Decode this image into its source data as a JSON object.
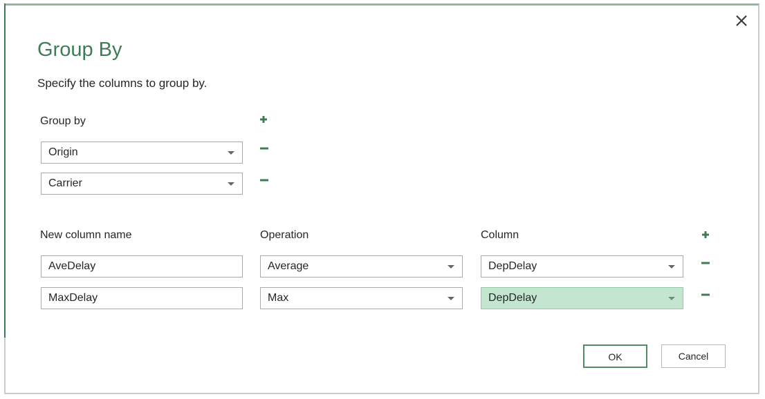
{
  "dialog": {
    "title": "Group By",
    "subtitle": "Specify the columns to group by.",
    "close_icon": "close-icon",
    "accent_color": "#3f7c56"
  },
  "group_by": {
    "label": "Group by",
    "rows": [
      {
        "value": "Origin"
      },
      {
        "value": "Carrier"
      }
    ]
  },
  "aggregations": {
    "headers": {
      "new_column_name": "New column name",
      "operation": "Operation",
      "column": "Column"
    },
    "rows": [
      {
        "name": "AveDelay",
        "operation": "Average",
        "column": "DepDelay"
      },
      {
        "name": "MaxDelay",
        "operation": "Max",
        "column": "DepDelay"
      }
    ]
  },
  "buttons": {
    "ok": "OK",
    "cancel": "Cancel"
  }
}
